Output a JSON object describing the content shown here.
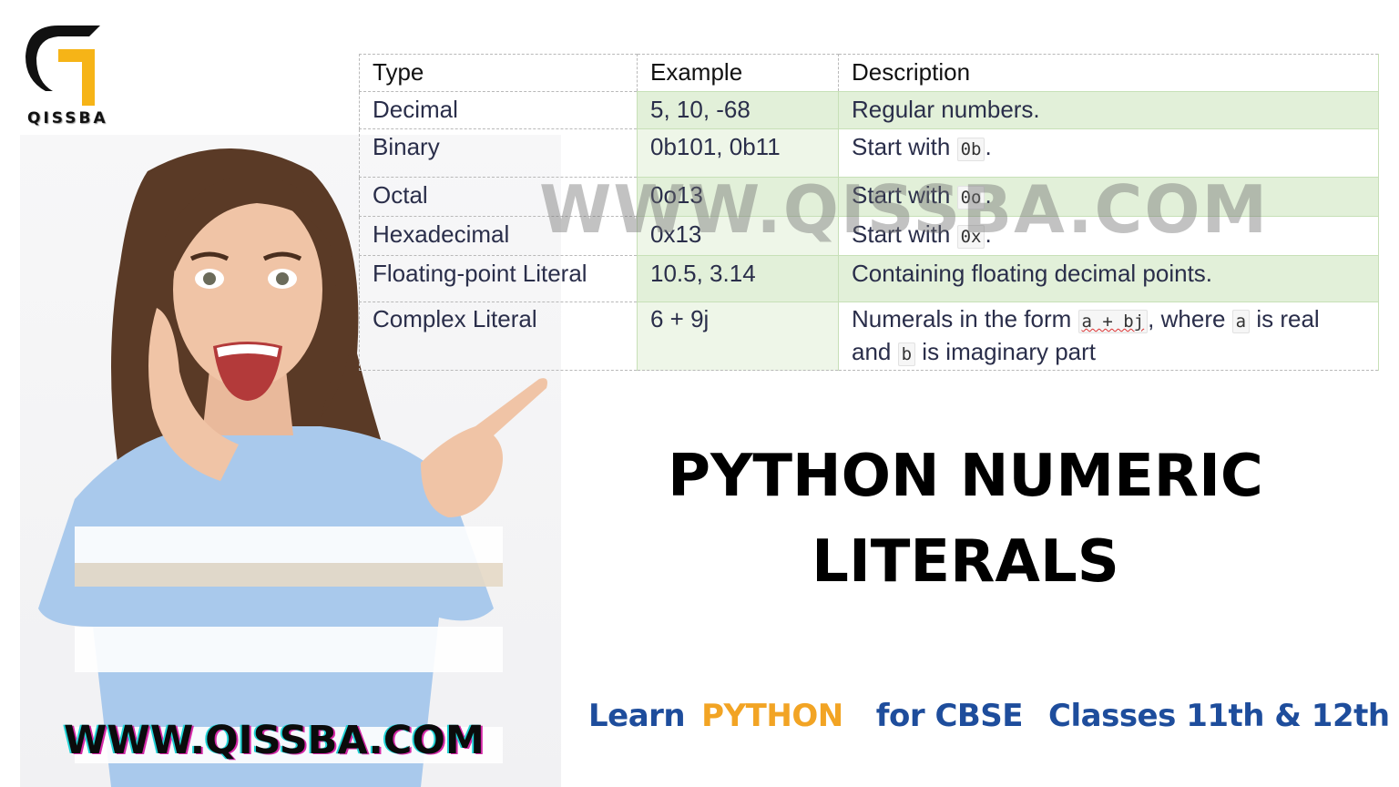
{
  "brand": {
    "logo_text": "QISSBA",
    "logo_icon": "q-letter-logo-icon",
    "colors": {
      "logo_black": "#111111",
      "logo_yellow": "#f6b417"
    }
  },
  "watermark": "WWW.QISSBA.COM",
  "table": {
    "headers": [
      "Type",
      "Example",
      "Description"
    ],
    "rows": [
      {
        "type": "Decimal",
        "example": "5, 10, -68",
        "description": [
          "Regular numbers."
        ],
        "highlight": true
      },
      {
        "type": "Binary",
        "example": "0b101, 0b11",
        "description": [
          "Start with ",
          {
            "code": "0b"
          },
          "."
        ],
        "highlight": false
      },
      {
        "type": "Octal",
        "example": "0o13",
        "description": [
          "Start with ",
          {
            "code": "0o"
          },
          "."
        ],
        "highlight": true
      },
      {
        "type": "Hexadecimal",
        "example": "0x13",
        "description": [
          "Start with ",
          {
            "code": "0x"
          },
          "."
        ],
        "highlight": false
      },
      {
        "type": "Floating-point Literal",
        "example": "10.5, 3.14",
        "description": [
          "Containing floating decimal points."
        ],
        "highlight": true
      },
      {
        "type": "Complex Literal",
        "example": "6 + 9j",
        "description": [
          "Numerals in the form ",
          {
            "code": "a + bj"
          },
          ", where ",
          {
            "code": "a"
          },
          " is real and ",
          {
            "code": "b"
          },
          " is imaginary part"
        ],
        "highlight": false
      }
    ],
    "colors": {
      "highlight": "#e2f0d9",
      "text": "#2a2e4a"
    }
  },
  "title": {
    "line1": "PYTHON NUMERIC",
    "line2": "LITERALS"
  },
  "tagline": {
    "part1": "Learn",
    "accent": "PYTHON",
    "part2": "for CBSE",
    "part3": "Classes 11th & 12th",
    "colors": {
      "main": "#1e4d9c",
      "accent": "#f2a424"
    }
  },
  "photo": {
    "description": "excited woman pointing",
    "url_banner": "WWW.QISSBA.COM"
  }
}
